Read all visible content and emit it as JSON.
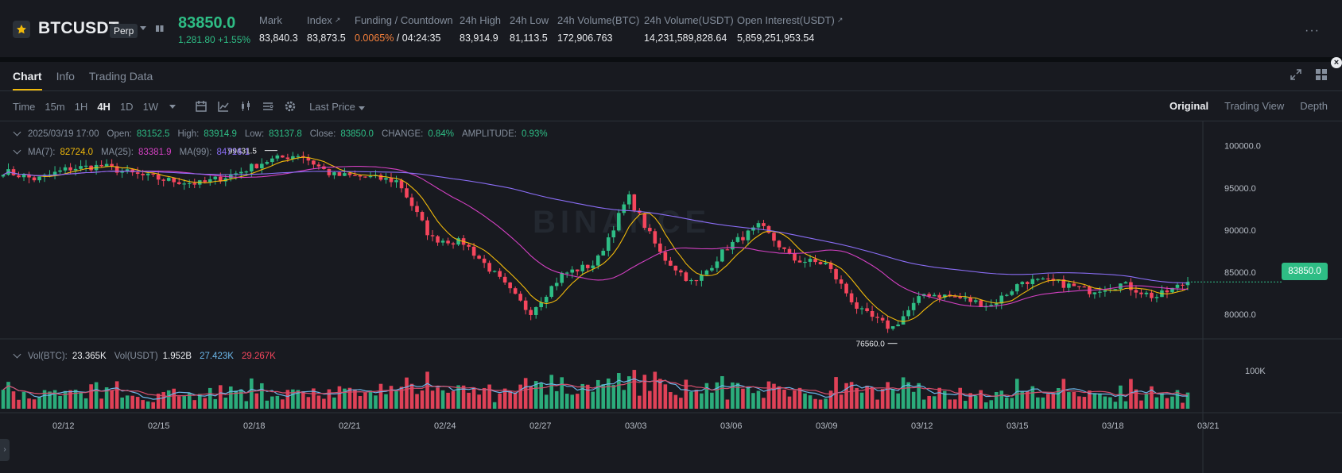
{
  "ticker": {
    "symbol": "BTCUSDT",
    "contract_type": "Perp",
    "last_price": "83850.0",
    "change": "1,281.80 +1.55%",
    "stats": [
      {
        "label": "Mark",
        "value": "83,840.3",
        "has_arrow": false
      },
      {
        "label": "Index",
        "value": "83,873.5",
        "has_arrow": true
      },
      {
        "label": "Funding / Countdown",
        "rate": "0.0065%",
        "countdown": "/ 04:24:35",
        "has_arrow": false
      },
      {
        "label": "24h High",
        "value": "83,914.9",
        "has_arrow": false
      },
      {
        "label": "24h Low",
        "value": "81,113.5",
        "has_arrow": false
      },
      {
        "label": "24h Volume(BTC)",
        "value": "172,906.763",
        "has_arrow": false
      },
      {
        "label": "24h Volume(USDT)",
        "value": "14,231,589,828.64",
        "has_arrow": false
      },
      {
        "label": "Open Interest(USDT)",
        "value": "5,859,251,953.54",
        "has_arrow": true
      }
    ],
    "more_label": "···"
  },
  "tabs": [
    {
      "label": "Chart",
      "active": true
    },
    {
      "label": "Info",
      "active": false
    },
    {
      "label": "Trading Data",
      "active": false
    }
  ],
  "toolbar": {
    "intervals": [
      {
        "label": "Time",
        "active": false
      },
      {
        "label": "15m",
        "active": false
      },
      {
        "label": "1H",
        "active": false
      },
      {
        "label": "4H",
        "active": true
      },
      {
        "label": "1D",
        "active": false
      },
      {
        "label": "1W",
        "active": false
      }
    ],
    "price_type": "Last Price",
    "icons": [
      "calendar-icon",
      "indicator-icon",
      "candle-type-icon",
      "template-icon",
      "settings-icon"
    ]
  },
  "views": [
    {
      "label": "Original",
      "active": true
    },
    {
      "label": "Trading View",
      "active": false
    },
    {
      "label": "Depth",
      "active": false
    }
  ],
  "ohlc": {
    "date": "2025/03/19 17:00",
    "open_label": "Open:",
    "open": "83152.5",
    "high_label": "High:",
    "high": "83914.9",
    "low_label": "Low:",
    "low": "83137.8",
    "close_label": "Close:",
    "close": "83850.0",
    "change_label": "CHANGE:",
    "change": "0.84%",
    "amplitude_label": "AMPLITUDE:",
    "amplitude": "0.93%"
  },
  "ma": {
    "ma7_label": "MA(7):",
    "ma7": "82724.0",
    "ma25_label": "MA(25):",
    "ma25": "83381.9",
    "ma99_label": "MA(99):",
    "ma99": "84716.1"
  },
  "vol": {
    "btc_label": "Vol(BTC):",
    "btc": "23.365K",
    "usdt_label": "Vol(USDT)",
    "usdt": "1.952B",
    "ma1": "27.423K",
    "ma2": "29.267K"
  },
  "current_price_tag": "83850.0",
  "watermark": "BINANCE",
  "colors": {
    "up": "#2ebd85",
    "down": "#f6465d",
    "ma7": "#f0b90b",
    "ma25": "#d340c2",
    "ma99": "#8a6df5",
    "accent": "#f0b90b"
  },
  "chart_data": {
    "type": "candlestick",
    "interval": "4H",
    "price_ticks": [
      "100000.0",
      "95000.0",
      "90000.0",
      "85000.0",
      "80000.0"
    ],
    "volume_ticks": [
      "100K"
    ],
    "x_ticks": [
      "02/12",
      "02/15",
      "02/18",
      "02/21",
      "02/24",
      "02/27",
      "03/03",
      "03/06",
      "03/09",
      "03/12",
      "03/15",
      "03/18",
      "03/21"
    ],
    "annotations": [
      {
        "label": "99431.5",
        "value": 99431.5,
        "kind": "high"
      },
      {
        "label": "76560.0",
        "value": 76560.0,
        "kind": "low"
      }
    ],
    "ylim": [
      77000,
      101000
    ],
    "close_path": [
      {
        "date": "02/12",
        "close": 97000
      },
      {
        "date": "02/13",
        "close": 96000
      },
      {
        "date": "02/14",
        "close": 97300
      },
      {
        "date": "02/15",
        "close": 97600
      },
      {
        "date": "02/16",
        "close": 96600
      },
      {
        "date": "02/17",
        "close": 95900
      },
      {
        "date": "02/18",
        "close": 95500
      },
      {
        "date": "02/19",
        "close": 96600
      },
      {
        "date": "02/20",
        "close": 98200
      },
      {
        "date": "02/21",
        "close": 99000
      },
      {
        "date": "02/22",
        "close": 96500
      },
      {
        "date": "02/23",
        "close": 96300
      },
      {
        "date": "02/24",
        "close": 95800
      },
      {
        "date": "02/25",
        "close": 89000
      },
      {
        "date": "02/26",
        "close": 88500
      },
      {
        "date": "02/27",
        "close": 84500
      },
      {
        "date": "02/28",
        "close": 80200
      },
      {
        "date": "03/01",
        "close": 84800
      },
      {
        "date": "03/02",
        "close": 86000
      },
      {
        "date": "03/03",
        "close": 94000
      },
      {
        "date": "03/04",
        "close": 87000
      },
      {
        "date": "03/05",
        "close": 83500
      },
      {
        "date": "03/06",
        "close": 88000
      },
      {
        "date": "03/07",
        "close": 90500
      },
      {
        "date": "03/08",
        "close": 86500
      },
      {
        "date": "03/09",
        "close": 86000
      },
      {
        "date": "03/10",
        "close": 80500
      },
      {
        "date": "03/11",
        "close": 78300
      },
      {
        "date": "03/12",
        "close": 82500
      },
      {
        "date": "03/13",
        "close": 82000
      },
      {
        "date": "03/14",
        "close": 81000
      },
      {
        "date": "03/15",
        "close": 84000
      },
      {
        "date": "03/16",
        "close": 83800
      },
      {
        "date": "03/17",
        "close": 82800
      },
      {
        "date": "03/18",
        "close": 83600
      },
      {
        "date": "03/19",
        "close": 82000
      },
      {
        "date": "03/19 17:00",
        "close": 83850
      }
    ]
  }
}
